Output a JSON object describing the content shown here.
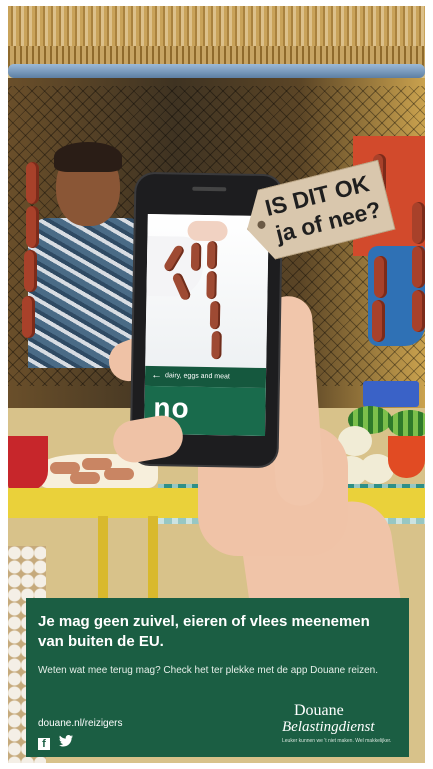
{
  "tag": {
    "line1": "IS DIT OK",
    "line2": "ja of nee?"
  },
  "phone": {
    "category_label": "dairy, eggs and meat",
    "answer": "no",
    "back_icon": "arrow-left-icon"
  },
  "panel": {
    "headline": "Je mag geen zuivel, eieren of vlees meenemen van buiten de EU.",
    "subtext": "Weten wat mee terug mag? Check het ter plekke met de app Douane reizen.",
    "url": "douane.nl/reizigers",
    "social_icons": [
      "facebook-icon",
      "twitter-icon"
    ],
    "logo_line1": "Douane",
    "logo_line2": "Belastingdienst",
    "logo_tagline": "Leuker kunnen we 't niet maken. Wel makkelijker."
  },
  "colors": {
    "panel_green": "#1b5e43",
    "app_green": "#196b4c",
    "tag_beige": "#d9c7ad"
  }
}
